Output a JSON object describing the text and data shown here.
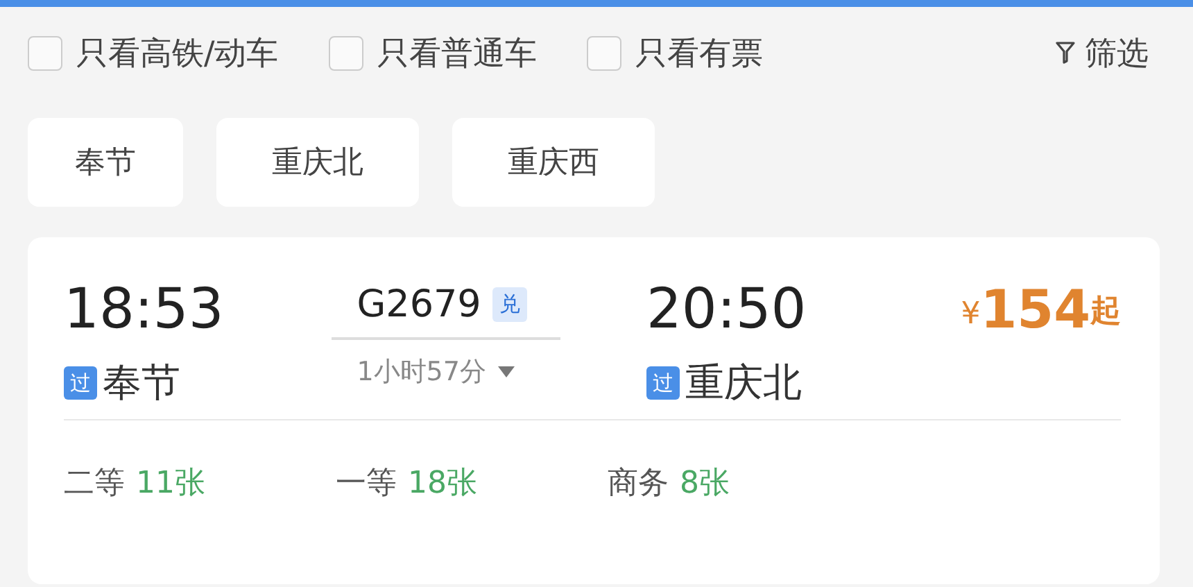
{
  "filters": [
    {
      "label": "只看高铁/动车",
      "checked": false
    },
    {
      "label": "只看普通车",
      "checked": false
    },
    {
      "label": "只看有票",
      "checked": false
    }
  ],
  "filter_button": {
    "label": "筛选"
  },
  "stations": [
    {
      "label": "奉节",
      "selected": false
    },
    {
      "label": "重庆北",
      "selected": false
    },
    {
      "label": "重庆西",
      "selected": false
    }
  ],
  "train": {
    "depart_time": "18:53",
    "depart_badge": "过",
    "depart_station": "奉节",
    "number": "G2679",
    "exchange_badge": "兑",
    "duration": "1小时57分",
    "arrive_time": "20:50",
    "arrive_badge": "过",
    "arrive_station": "重庆北",
    "price": {
      "currency": "¥",
      "amount": "154",
      "suffix": "起"
    },
    "seats": [
      {
        "class": "二等",
        "count": "11张"
      },
      {
        "class": "一等",
        "count": "18张"
      },
      {
        "class": "商务",
        "count": "8张"
      }
    ]
  }
}
